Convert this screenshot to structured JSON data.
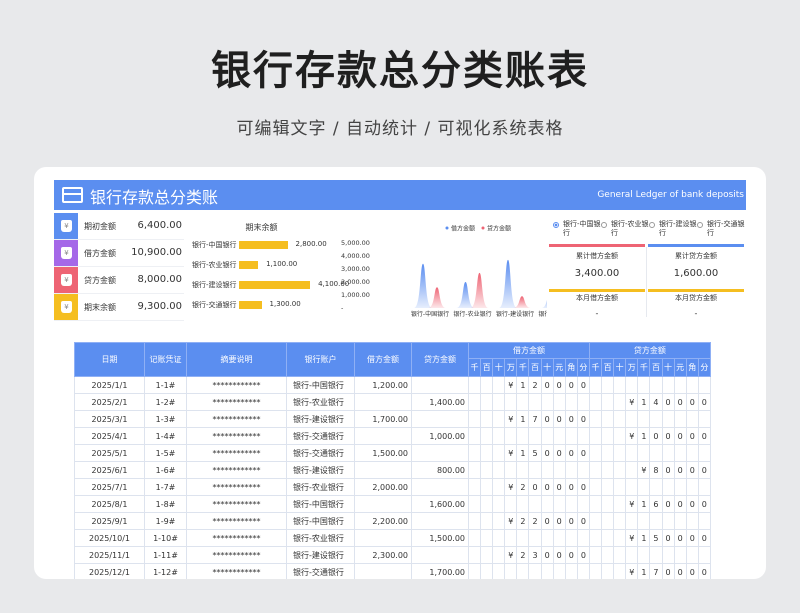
{
  "headline": "银行存款总分类账表",
  "subline": "可编辑文字 / 自动统计 / 可视化系统表格",
  "sheet": {
    "title": "银行存款总分类账",
    "subtitle_en": "General Ledger of bank deposits"
  },
  "summary": [
    {
      "label": "期初金额",
      "value": "6,400.00",
      "color": "#5b8ef0",
      "icon": "money-bag-icon"
    },
    {
      "label": "借方金额",
      "value": "10,900.00",
      "color": "#a568e8",
      "icon": "money-bag-icon"
    },
    {
      "label": "贷方金额",
      "value": "8,000.00",
      "color": "#ee6474",
      "icon": "money-bag-icon"
    },
    {
      "label": "期末余额",
      "value": "9,300.00",
      "color": "#f5be20",
      "icon": "money-bag-icon"
    }
  ],
  "balance_chart": {
    "title": "期末余额",
    "type": "bar",
    "categories": [
      "银行-中国银行",
      "银行-农业银行",
      "银行-建设银行",
      "银行-交通银行"
    ],
    "values": [
      2800,
      1100,
      4100,
      1300
    ],
    "value_labels": [
      "2,800.00",
      "1,100.00",
      "4,100.00",
      "1,300.00"
    ],
    "xlim": [
      0,
      4500
    ],
    "color": "#f5be20"
  },
  "chart_data": {
    "type": "area",
    "categories": [
      "银行-中国银行",
      "银行-农业银行",
      "银行-建设银行",
      "银行-交通银行"
    ],
    "series": [
      {
        "name": "借方金额",
        "values": [
          3400,
          2000,
          3700,
          1600
        ],
        "color": "#5b8ef0"
      },
      {
        "name": "贷方金额",
        "values": [
          1600,
          2700,
          900,
          1900
        ],
        "color": "#ee6474"
      }
    ],
    "y_ticks": [
      "5,000.00",
      "4,000.00",
      "3,000.00",
      "2,000.00",
      "1,000.00",
      "-"
    ],
    "ylim": [
      0,
      5000
    ],
    "legend": "top-center"
  },
  "stats": {
    "radios": [
      {
        "label": "银行-中国银行",
        "selected": true
      },
      {
        "label": "银行-农业银行",
        "selected": false
      },
      {
        "label": "银行-建设银行",
        "selected": false
      },
      {
        "label": "银行-交通银行",
        "selected": false
      }
    ],
    "boxes": [
      {
        "label": "累计借方金额",
        "value": "3,400.00",
        "color": "#f5be20"
      },
      {
        "label": "累计贷方金额",
        "value": "1,600.00",
        "color": "#f5be20"
      },
      {
        "label": "本月借方金额",
        "value": "-",
        "color": "#a568e8"
      },
      {
        "label": "本月贷方金额",
        "value": "-",
        "color": "#5b8ef0"
      }
    ],
    "strips": [
      "#ee6474",
      "#5b8ef0"
    ]
  },
  "ledger": {
    "headers": [
      "日期",
      "记账凭证",
      "摘要说明",
      "银行账户",
      "借方金额",
      "贷方金额"
    ],
    "debit_group": "借方金额",
    "credit_group": "贷方金额",
    "digits": [
      "千",
      "百",
      "十",
      "万",
      "千",
      "百",
      "十",
      "元",
      "角",
      "分"
    ],
    "rows": [
      {
        "date": "2025/1/1",
        "voucher": "1-1#",
        "memo": "************",
        "account": "银行-中国银行",
        "debit": "1,200.00",
        "credit": "",
        "dd": [
          "",
          "",
          "",
          "¥",
          "1",
          "2",
          "0",
          "0",
          "0",
          "0"
        ],
        "cd": [
          "",
          "",
          "",
          "",
          "",
          "",
          "",
          "",
          "",
          ""
        ]
      },
      {
        "date": "2025/2/1",
        "voucher": "1-2#",
        "memo": "************",
        "account": "银行-农业银行",
        "debit": "",
        "credit": "1,400.00",
        "dd": [
          "",
          "",
          "",
          "",
          "",
          "",
          "",
          "",
          "",
          ""
        ],
        "cd": [
          "",
          "",
          "",
          "¥",
          "1",
          "4",
          "0",
          "0",
          "0",
          "0"
        ]
      },
      {
        "date": "2025/3/1",
        "voucher": "1-3#",
        "memo": "************",
        "account": "银行-建设银行",
        "debit": "1,700.00",
        "credit": "",
        "dd": [
          "",
          "",
          "",
          "¥",
          "1",
          "7",
          "0",
          "0",
          "0",
          "0"
        ],
        "cd": [
          "",
          "",
          "",
          "",
          "",
          "",
          "",
          "",
          "",
          ""
        ]
      },
      {
        "date": "2025/4/1",
        "voucher": "1-4#",
        "memo": "************",
        "account": "银行-交通银行",
        "debit": "",
        "credit": "1,000.00",
        "dd": [
          "",
          "",
          "",
          "",
          "",
          "",
          "",
          "",
          "",
          ""
        ],
        "cd": [
          "",
          "",
          "",
          "¥",
          "1",
          "0",
          "0",
          "0",
          "0",
          "0"
        ]
      },
      {
        "date": "2025/5/1",
        "voucher": "1-5#",
        "memo": "************",
        "account": "银行-交通银行",
        "debit": "1,500.00",
        "credit": "",
        "dd": [
          "",
          "",
          "",
          "¥",
          "1",
          "5",
          "0",
          "0",
          "0",
          "0"
        ],
        "cd": [
          "",
          "",
          "",
          "",
          "",
          "",
          "",
          "",
          "",
          ""
        ]
      },
      {
        "date": "2025/6/1",
        "voucher": "1-6#",
        "memo": "************",
        "account": "银行-建设银行",
        "debit": "",
        "credit": "800.00",
        "dd": [
          "",
          "",
          "",
          "",
          "",
          "",
          "",
          "",
          "",
          ""
        ],
        "cd": [
          "",
          "",
          "",
          "",
          "¥",
          "8",
          "0",
          "0",
          "0",
          "0"
        ]
      },
      {
        "date": "2025/7/1",
        "voucher": "1-7#",
        "memo": "************",
        "account": "银行-农业银行",
        "debit": "2,000.00",
        "credit": "",
        "dd": [
          "",
          "",
          "",
          "¥",
          "2",
          "0",
          "0",
          "0",
          "0",
          "0"
        ],
        "cd": [
          "",
          "",
          "",
          "",
          "",
          "",
          "",
          "",
          "",
          ""
        ]
      },
      {
        "date": "2025/8/1",
        "voucher": "1-8#",
        "memo": "************",
        "account": "银行-中国银行",
        "debit": "",
        "credit": "1,600.00",
        "dd": [
          "",
          "",
          "",
          "",
          "",
          "",
          "",
          "",
          "",
          ""
        ],
        "cd": [
          "",
          "",
          "",
          "¥",
          "1",
          "6",
          "0",
          "0",
          "0",
          "0"
        ]
      },
      {
        "date": "2025/9/1",
        "voucher": "1-9#",
        "memo": "************",
        "account": "银行-中国银行",
        "debit": "2,200.00",
        "credit": "",
        "dd": [
          "",
          "",
          "",
          "¥",
          "2",
          "2",
          "0",
          "0",
          "0",
          "0"
        ],
        "cd": [
          "",
          "",
          "",
          "",
          "",
          "",
          "",
          "",
          "",
          ""
        ]
      },
      {
        "date": "2025/10/1",
        "voucher": "1-10#",
        "memo": "************",
        "account": "银行-农业银行",
        "debit": "",
        "credit": "1,500.00",
        "dd": [
          "",
          "",
          "",
          "",
          "",
          "",
          "",
          "",
          "",
          ""
        ],
        "cd": [
          "",
          "",
          "",
          "¥",
          "1",
          "5",
          "0",
          "0",
          "0",
          "0"
        ]
      },
      {
        "date": "2025/11/1",
        "voucher": "1-11#",
        "memo": "************",
        "account": "银行-建设银行",
        "debit": "2,300.00",
        "credit": "",
        "dd": [
          "",
          "",
          "",
          "¥",
          "2",
          "3",
          "0",
          "0",
          "0",
          "0"
        ],
        "cd": [
          "",
          "",
          "",
          "",
          "",
          "",
          "",
          "",
          "",
          ""
        ]
      },
      {
        "date": "2025/12/1",
        "voucher": "1-12#",
        "memo": "************",
        "account": "银行-交通银行",
        "debit": "",
        "credit": "1,700.00",
        "dd": [
          "",
          "",
          "",
          "",
          "",
          "",
          "",
          "",
          "",
          ""
        ],
        "cd": [
          "",
          "",
          "",
          "¥",
          "1",
          "7",
          "0",
          "0",
          "0",
          "0"
        ]
      }
    ]
  }
}
